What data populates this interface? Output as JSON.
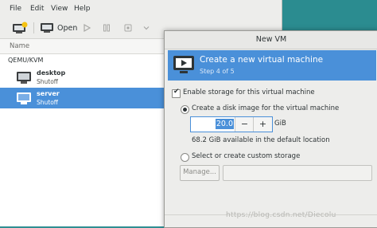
{
  "menu": [
    "File",
    "Edit",
    "View",
    "Help"
  ],
  "toolbar": {
    "open_label": "Open"
  },
  "list": {
    "column_name": "Name",
    "group": "QEMU/KVM",
    "vms": [
      {
        "name": "desktop",
        "state": "Shutoff",
        "selected": false
      },
      {
        "name": "server",
        "state": "Shutoff",
        "selected": true
      }
    ]
  },
  "dialog": {
    "title": "New VM",
    "banner_title": "Create a new virtual machine",
    "banner_step": "Step 4 of 5",
    "enable_storage": "Enable storage for this virtual machine",
    "create_disk": "Create a disk image for the virtual machine",
    "size_value": "20.0",
    "size_unit": "GiB",
    "minus": "−",
    "plus": "+",
    "available": "68.2 GiB available in the default location",
    "custom_storage": "Select or create custom storage",
    "manage_button": "Manage...",
    "path_value": ""
  },
  "watermark": "https://blog.csdn.net/Diecolu",
  "colors": {
    "accent": "#4a90d9",
    "desktop": "#2f8f93"
  }
}
